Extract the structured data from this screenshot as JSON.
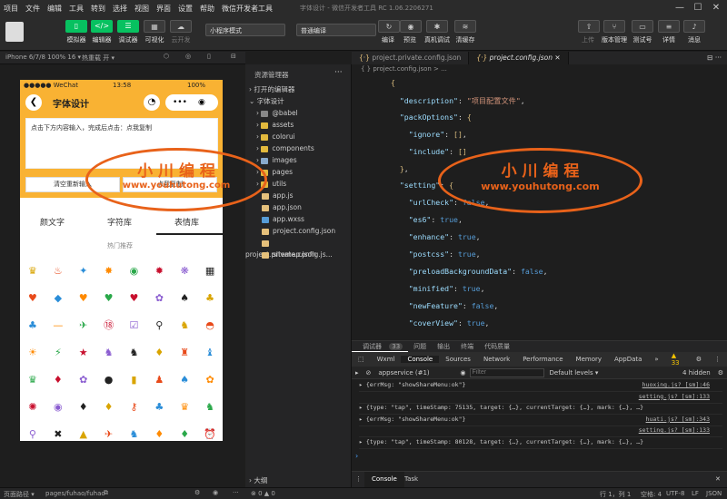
{
  "menu": [
    "项目",
    "文件",
    "编辑",
    "工具",
    "转到",
    "选择",
    "视图",
    "界面",
    "设置",
    "帮助",
    "微信开发者工具"
  ],
  "window_title": "字体设计 - 微信开发者工具 RC 1.06.2206271",
  "toolbar": {
    "simulator": "模拟器",
    "editor": "编辑器",
    "debugger": "调试器",
    "visual": "可视化",
    "cloud": "云开发",
    "mode": "小程序模式",
    "compile": "普通编译",
    "compile_btn": "编译",
    "preview": "预览",
    "remote_debug": "真机调试",
    "clear_cache": "清缓存",
    "upload": "上传",
    "version": "版本管理",
    "test": "测试号",
    "details": "详情",
    "messages": "消息"
  },
  "simulator_bar": {
    "device": "iPhone 6/7/8 100% 16 ▾",
    "hot_reload": "热重载 开 ▾"
  },
  "phone": {
    "carrier": "●●●●● WeChat",
    "time": "13:58",
    "battery": "100%",
    "title": "字体设计",
    "input_hint": "点击下方内容输入，完成后点击：点我复制",
    "clear_btn": "清空重新输入",
    "copy_btn": "点我复制",
    "tabs": [
      "颜文字",
      "字符库",
      "表情库"
    ],
    "section": "热门推荐",
    "emoji_rows": [
      [
        "♛",
        "♨",
        "✦",
        "✸",
        "◉",
        "✹",
        "❋",
        "▦"
      ],
      [
        "♥",
        "◆",
        "♥",
        "♥",
        "♥",
        "✿",
        "♠",
        "♣"
      ],
      [
        "♣",
        "—",
        "✈",
        "⑱",
        "☑",
        "⚲",
        "♞",
        "◓"
      ],
      [
        "☀",
        "⚡",
        "★",
        "♞",
        "♞",
        "♦",
        "♜",
        "♝"
      ],
      [
        "♛",
        "♦",
        "✿",
        "●",
        "▮",
        "♟",
        "♠",
        "✿"
      ],
      [
        "✺",
        "◉",
        "♦",
        "♦",
        "⚷",
        "♣",
        "♛",
        "♞"
      ],
      [
        "⚲",
        "✖",
        "▲",
        "✈",
        "♞",
        "♦",
        "♦",
        "⏰"
      ]
    ]
  },
  "explorer": {
    "title": "资源管理器",
    "open_editors": "打开的编辑器",
    "project": "字体设计",
    "items": [
      "@babel",
      "assets",
      "colorui",
      "components",
      "images",
      "pages",
      "utils",
      "app.js",
      "app.json",
      "app.wxss",
      "project.config.json",
      "project.private.config.js...",
      "sitemap.json"
    ],
    "outline": "大纲"
  },
  "editor": {
    "tabs": [
      "project.private.config.json",
      "project.config.json"
    ],
    "breadcrumb": "{ } project.config.json > ...",
    "lines": [
      "{",
      "  \"description\": \"项目配置文件\",",
      "  \"packOptions\": {",
      "    \"ignore\": [],",
      "    \"include\": []",
      "  },",
      "  \"setting\": {",
      "    \"urlCheck\": false,",
      "    \"es6\": true,",
      "    \"enhance\": true,",
      "    \"postcss\": true,",
      "    \"preloadBackgroundData\": false,",
      "    \"minified\": true,",
      "    \"newFeature\": false,",
      "    \"coverView\": true,"
    ]
  },
  "devtools": {
    "top_tabs": [
      "调试器",
      "33",
      "问题",
      "输出",
      "终端",
      "代码质量"
    ],
    "tabs": [
      "Wxml",
      "Console",
      "Sources",
      "Network",
      "Performance",
      "Memory",
      "AppData"
    ],
    "warnings": "▲ 33",
    "context": "appservice (#1)",
    "filter_placeholder": "Filter",
    "levels": "Default levels ▾",
    "hidden": "4 hidden",
    "logs": [
      {
        "text": "▸ {errMsg: \"showShareMenu:ok\"}",
        "src": "huoxing.js? [sm]:46"
      },
      {
        "text": "",
        "src": "setting.js? [sm]:133"
      },
      {
        "text": "▸ {type: \"tap\", timeStamp: 75135, target: {…}, currentTarget: {…}, mark: {…}, …}",
        "src": ""
      },
      {
        "text": "▸ {errMsg: \"showShareMenu:ok\"}",
        "src": "huati.js? [sm]:343"
      },
      {
        "text": "",
        "src": "setting.js? [sm]:133"
      },
      {
        "text": "▸ {type: \"tap\", timeStamp: 80128, target: {…}, currentTarget: {…}, mark: {…}, …}",
        "src": ""
      }
    ],
    "bottom_tabs": [
      "Console",
      "Task"
    ]
  },
  "statusbar": {
    "path_label": "页面路径 ▾",
    "path": "pages/fuhao/fuhao",
    "errors": "⊗ 0 ▲ 0",
    "position": "行 1，列 1",
    "spaces": "空格: 4",
    "encoding": "UTF-8",
    "eol": "LF",
    "lang": "JSON"
  },
  "watermark": {
    "cn": "小 川 编 程",
    "url": "www.youhutong.com"
  }
}
